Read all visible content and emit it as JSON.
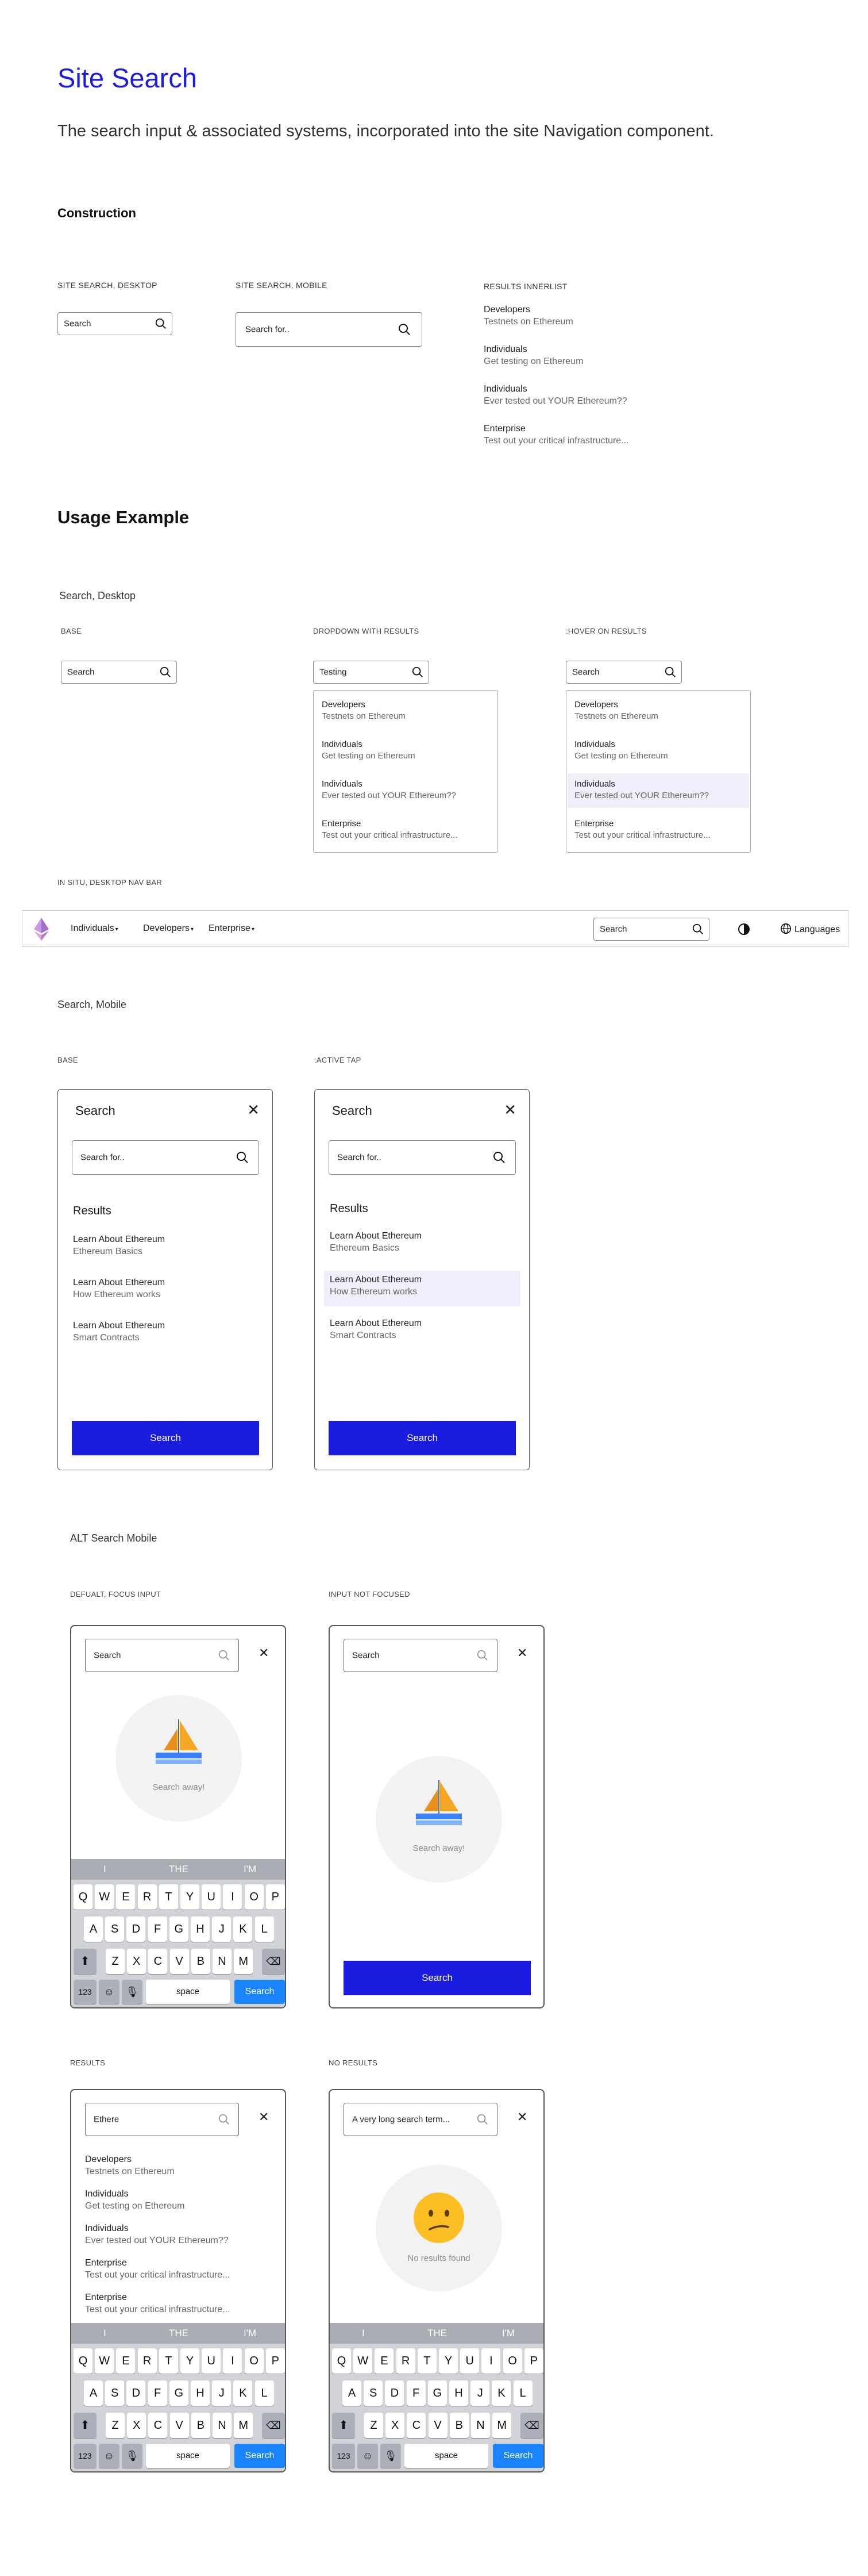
{
  "header": {
    "title": "Site Search",
    "subtitle": "The search input & associated systems, incorporated into the site Navigation component."
  },
  "construction": {
    "heading": "Construction",
    "desktop_caption": "SITE SEARCH, DESKTOP",
    "desktop_placeholder": "Search",
    "mobile_caption": "SITE SEARCH, MOBILE",
    "mobile_placeholder": "Search for..",
    "innerlist_caption": "RESULTS INNERLIST",
    "innerlist": [
      {
        "title": "Developers",
        "desc": "Testnets on Ethereum"
      },
      {
        "title": "Individuals",
        "desc": "Get testing on Ethereum"
      },
      {
        "title": "Individuals",
        "desc": "Ever tested out YOUR Ethereum??"
      },
      {
        "title": "Enterprise",
        "desc": "Test out your critical infrastructure..."
      }
    ]
  },
  "usage": {
    "heading": "Usage Example",
    "desktop_heading": "Search, Desktop",
    "base_caption": "BASE",
    "base_value": "Search",
    "dropdown_caption": "DROPDOWN WITH RESULTS",
    "dropdown_value": "Testing",
    "hover_caption": ":HOVER ON RESULTS",
    "hover_value": "Search",
    "results": [
      {
        "title": "Developers",
        "desc": "Testnets on Ethereum"
      },
      {
        "title": "Individuals",
        "desc": "Get testing on Ethereum"
      },
      {
        "title": "Individuals",
        "desc": "Ever tested out YOUR Ethereum??"
      },
      {
        "title": "Enterprise",
        "desc": "Test out your critical infrastructure..."
      }
    ],
    "insitu_caption": "IN SITU, DESKTOP NAV BAR",
    "nav": {
      "items": [
        "Individuals",
        "Developers",
        "Enterprise"
      ],
      "search_placeholder": "Search",
      "languages": "Languages"
    }
  },
  "mobile": {
    "heading": "Search, Mobile",
    "base_caption": "BASE",
    "active_caption": ":ACTIVE TAP",
    "panel_title": "Search",
    "placeholder": "Search for..",
    "results_heading": "Results",
    "results": [
      {
        "title": "Learn About Ethereum",
        "desc": "Ethereum Basics"
      },
      {
        "title": "Learn About Ethereum",
        "desc": "How Ethereum works"
      },
      {
        "title": "Learn About Ethereum",
        "desc": "Smart Contracts"
      }
    ],
    "button": "Search"
  },
  "alt": {
    "heading": "ALT Search Mobile",
    "default_caption": "DEFUALT, FOCUS INPUT",
    "notfocused_caption": "INPUT NOT FOCUSED",
    "results_caption": "RESULTS",
    "noresults_caption": "NO RESULTS",
    "placeholder": "Search",
    "illustration_text": "Search away!",
    "results_value": "Ethere",
    "long_value": "A very long search term...",
    "no_results_text": "No results found",
    "button": "Search",
    "results": [
      {
        "title": "Developers",
        "desc": "Testnets on Ethereum"
      },
      {
        "title": "Individuals",
        "desc": "Get testing on Ethereum"
      },
      {
        "title": "Individuals",
        "desc": "Ever tested out YOUR Ethereum??"
      },
      {
        "title": "Enterprise",
        "desc": "Test out your critical infrastructure..."
      },
      {
        "title": "Enterprise",
        "desc": "Test out your critical infrastructure..."
      }
    ],
    "keyboard": {
      "suggestions": [
        "I",
        "THE",
        "I'M"
      ],
      "row1": [
        "Q",
        "W",
        "E",
        "R",
        "T",
        "Y",
        "U",
        "I",
        "O",
        "P"
      ],
      "row2": [
        "A",
        "S",
        "D",
        "F",
        "G",
        "H",
        "J",
        "K",
        "L"
      ],
      "row3": [
        "Z",
        "X",
        "C",
        "V",
        "B",
        "N",
        "M"
      ],
      "numbers": "123",
      "space": "space",
      "search": "Search"
    }
  },
  "colors": {
    "accent": "#1c1ce1",
    "hover": "#efeffb",
    "keyboard": "#d1d3d9",
    "ios_blue": "#1a84ff"
  }
}
